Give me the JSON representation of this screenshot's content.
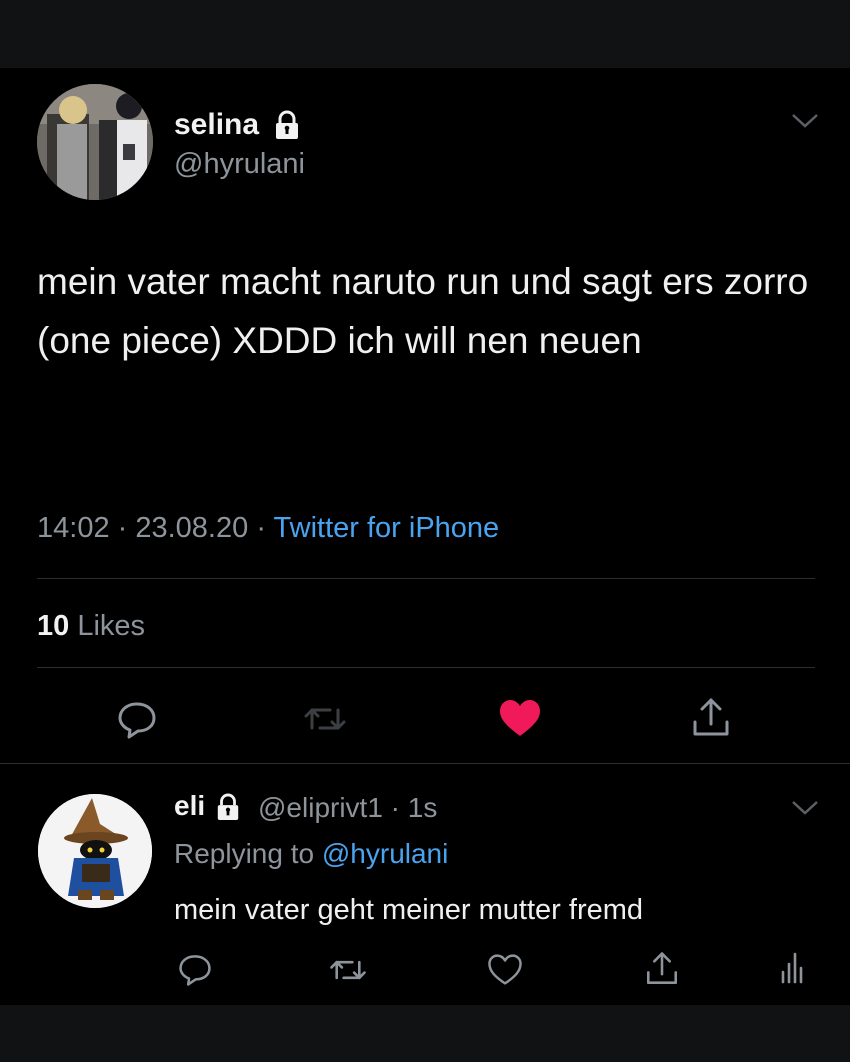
{
  "tweet": {
    "display_name": "selina",
    "handle": "@hyrulani",
    "text": "mein vater macht naruto run und sagt ers zorro (one piece) XDDD ich will nen neuen",
    "time": "14:02",
    "date": "23.08.20",
    "source": "Twitter for iPhone",
    "likes_count": "10",
    "likes_label": "Likes",
    "liked": true
  },
  "reply": {
    "display_name": "eli",
    "handle": "@eliprivt1",
    "age": "1s",
    "replying_label": "Replying to",
    "replying_handle": "@hyrulani",
    "text": "mein vater geht meiner mutter fremd"
  },
  "colors": {
    "background": "#000000",
    "text": "#f0f0f0",
    "secondary": "#8e949b",
    "link": "#4aa3ef",
    "like": "#f0195a"
  },
  "icons": {
    "protected": "lock-icon",
    "menu": "chevron-down-icon",
    "reply": "reply-icon",
    "retweet": "retweet-icon",
    "like": "heart-icon",
    "share": "share-icon",
    "analytics": "analytics-icon"
  }
}
